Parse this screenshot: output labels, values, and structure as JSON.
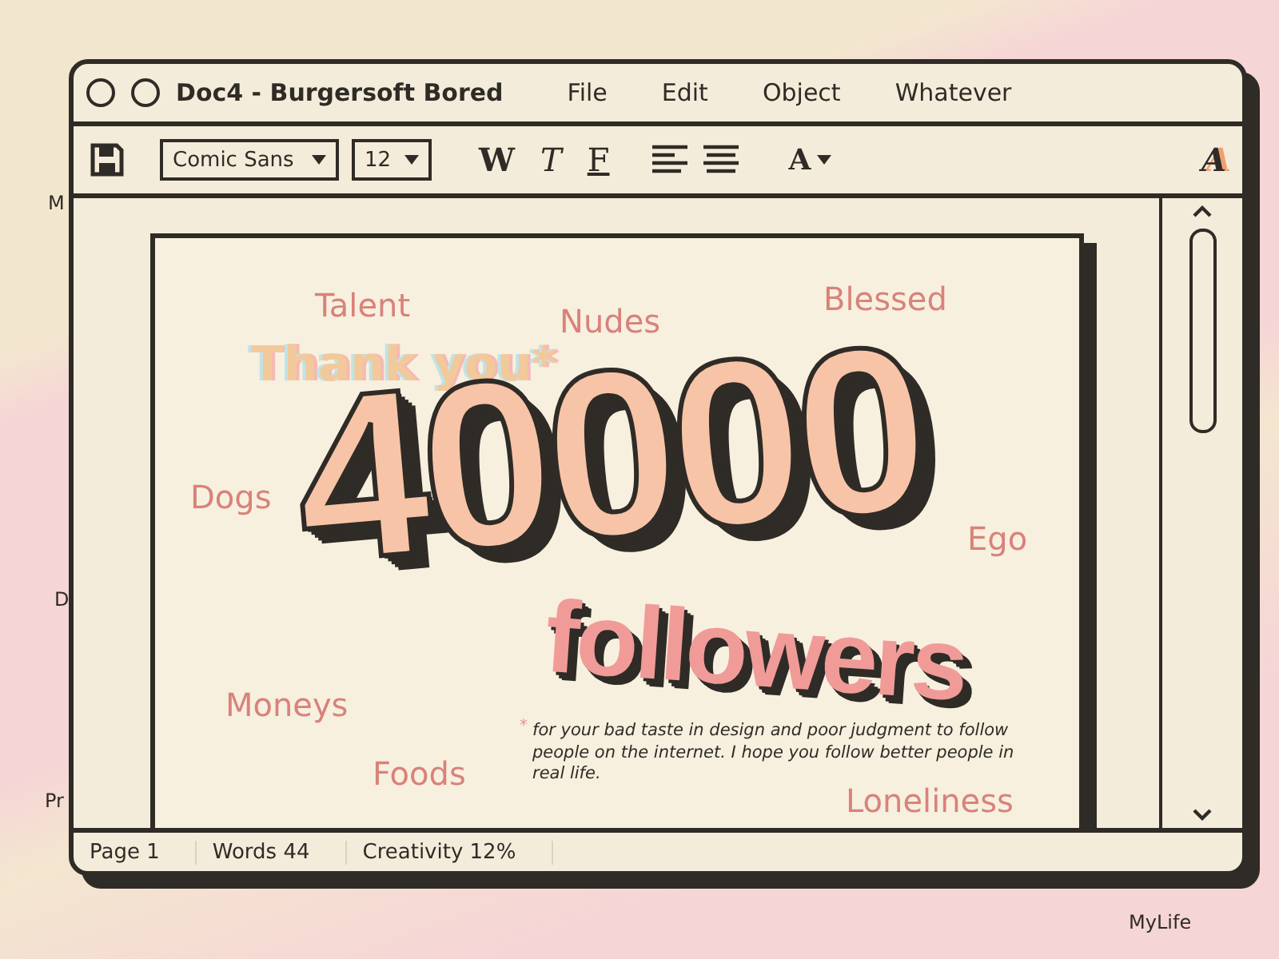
{
  "desktop_left": [
    "M",
    "D",
    "Pr"
  ],
  "desktop_right": [
    "MyLife"
  ],
  "window": {
    "title": "Doc4 - Burgersoft Bored",
    "menu": [
      "File",
      "Edit",
      "Object",
      "Whatever"
    ]
  },
  "toolbar": {
    "font": "Comic Sans",
    "size": "12",
    "style_buttons": [
      "W",
      "T",
      "F"
    ],
    "color_button": "A",
    "logo_letter": "A"
  },
  "document": {
    "words": [
      {
        "text": "Talent",
        "kind": "faint"
      },
      {
        "text": "Nudes",
        "kind": "faint"
      },
      {
        "text": "Blessed",
        "kind": "faint"
      },
      {
        "text": "Thank you*",
        "kind": "thanks"
      },
      {
        "text": "40000",
        "kind": "big"
      },
      {
        "text": "Dogs",
        "kind": "faint"
      },
      {
        "text": "Ego",
        "kind": "faint"
      },
      {
        "text": "followers",
        "kind": "sub"
      },
      {
        "text": "Moneys",
        "kind": "faint"
      },
      {
        "text": "Foods",
        "kind": "faint"
      },
      {
        "text": "Loneliness",
        "kind": "faint"
      }
    ],
    "footnote": {
      "mark": "*",
      "text": "for your bad taste in design and poor judgment to follow people on the internet. I hope you follow better people in real life."
    }
  },
  "status_bar": [
    "Page 1",
    "Words 44",
    "Creativity 12%"
  ]
}
